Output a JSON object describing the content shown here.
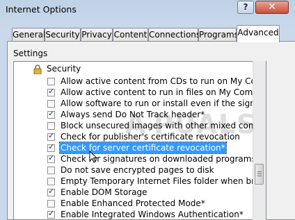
{
  "window": {
    "title": "Internet Options",
    "help_label": "?",
    "close_label": "✕"
  },
  "tabs": [
    "General",
    "Security",
    "Privacy",
    "Content",
    "Connections",
    "Programs",
    "Advanced"
  ],
  "active_tab": "Advanced",
  "settings": {
    "group_label": "Settings",
    "category": "Security",
    "items": [
      {
        "label": "Allow active content from CDs to run on My Computer*",
        "checked": false
      },
      {
        "label": "Allow active content to run in files on My Computer*",
        "checked": true
      },
      {
        "label": "Allow software to run or install even if the signature is inva",
        "checked": false
      },
      {
        "label": "Always send Do Not Track header*",
        "checked": true
      },
      {
        "label": "Block unsecured images with other mixed content",
        "checked": false
      },
      {
        "label": "Check for publisher's certificate revocation",
        "checked": true
      },
      {
        "label": "Check for server certificate revocation*",
        "checked": true,
        "selected": true
      },
      {
        "label": "Check for signatures on downloaded programs",
        "checked": true
      },
      {
        "label": "Do not save encrypted pages to disk",
        "checked": false
      },
      {
        "label": "Empty Temporary Internet Files folder when browser is clo",
        "checked": false
      },
      {
        "label": "Enable DOM Storage",
        "checked": true
      },
      {
        "label": "Enable Enhanced Protected Mode*",
        "checked": false
      },
      {
        "label": "Enable Integrated Windows Authentication*",
        "checked": true
      }
    ]
  },
  "watermark": "A PUALS",
  "colors": {
    "selection": "#3399ff",
    "title_bar": "#c2d3e6",
    "close_button": "#c7503a"
  }
}
